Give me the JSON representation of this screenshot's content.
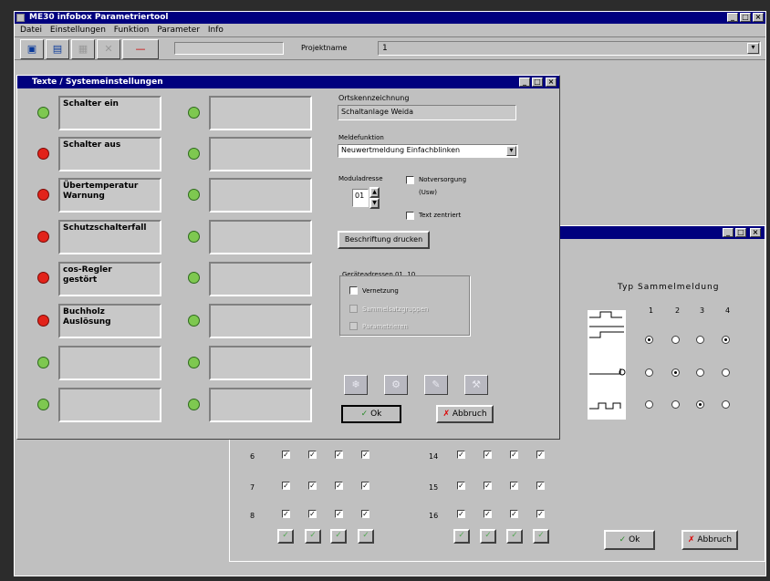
{
  "app": {
    "title": "ME30 infobox Parametriertool"
  },
  "menu": [
    "Datei",
    "Einstellungen",
    "Funktion",
    "Parameter",
    "Info"
  ],
  "toolbar": {
    "project_label": "Projektname",
    "project_value": "1"
  },
  "texte": {
    "title": "Texte / Systemeinstellungen",
    "left_labels": [
      "Schalter ein",
      "Schalter aus",
      "Übertemperatur\nWarnung",
      "Schutzschalterfall",
      "cos-Regler\ngestört",
      "Buchholz\nAuslösung",
      "",
      ""
    ],
    "left_leds": [
      "green",
      "red",
      "red",
      "red",
      "red",
      "red",
      "green",
      "green"
    ],
    "right_leds": [
      "green",
      "green",
      "green",
      "green",
      "green",
      "green",
      "green",
      "green"
    ],
    "ortskenn_label": "Ortskennzeichnung",
    "ortskenn_value": "Schaltanlage Weida",
    "meldefunktion_label": "Meldefunktion",
    "meldefunktion_value": "Neuwertmeldung Einfachblinken",
    "modul_label": "Moduladresse",
    "modul_value": "01",
    "notversorgung_label": "Notversorgung",
    "notversorgung_sub": "(Usw)",
    "text_zentriert_label": "Text zentriert",
    "beschriftung_button": "Beschriftung drucken",
    "geraete_title": "Geräteadressen 01..10",
    "vernetzung_label": "Vernetzung",
    "disabled1": "Sammelsatzgruppen",
    "disabled2": "Parametrieren",
    "ok_label": "Ok",
    "abbruch_label": "Abbruch"
  },
  "sammel": {
    "title": "Typ Sammelmeldung",
    "col_heads": [
      "1",
      "2",
      "3",
      "4"
    ],
    "radio_rows": [
      [
        true,
        false,
        false,
        true
      ],
      [
        false,
        true,
        false,
        false
      ],
      [
        false,
        false,
        true,
        false
      ]
    ],
    "row_numbers_left": [
      "6",
      "7",
      "8"
    ],
    "row_numbers_right": [
      "14",
      "15",
      "16"
    ],
    "ok_label": "Ok",
    "abbruch_label": "Abbruch"
  }
}
